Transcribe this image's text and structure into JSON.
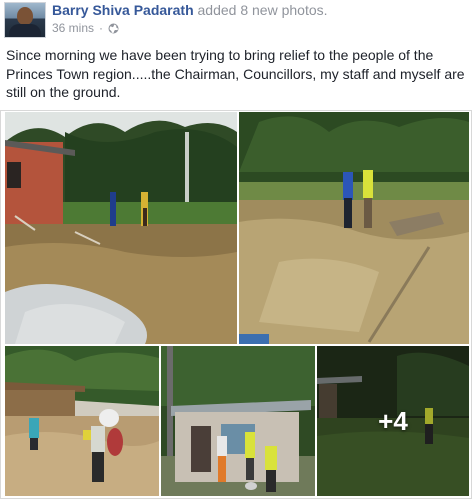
{
  "post": {
    "author": "Barry Shiva Padarath",
    "action": "added 8 new photos.",
    "timestamp": "36 mins",
    "separator": "·",
    "privacy_icon": "globe-icon",
    "text": "Since morning we have been trying to bring relief to the people of the Princes Town region.....the Chairman, Councillors, my staff and myself are still on the ground."
  },
  "photos": [
    {
      "name": "photo-flooded-yard",
      "description_icon": "photo"
    },
    {
      "name": "photo-officials-in-mud"
    },
    {
      "name": "photo-wading-floodwater"
    },
    {
      "name": "photo-house-relief"
    },
    {
      "name": "photo-more-photos",
      "more_label": "+4"
    }
  ]
}
